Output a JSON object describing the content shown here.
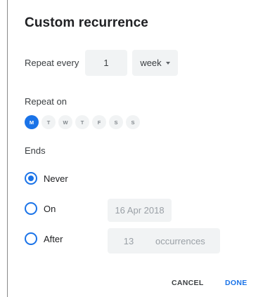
{
  "dialog": {
    "title": "Custom recurrence"
  },
  "repeat": {
    "label": "Repeat every",
    "interval": "1",
    "unit": "week"
  },
  "repeat_on": {
    "label": "Repeat on",
    "days": [
      {
        "letter": "M",
        "selected": true
      },
      {
        "letter": "T",
        "selected": false
      },
      {
        "letter": "W",
        "selected": false
      },
      {
        "letter": "T",
        "selected": false
      },
      {
        "letter": "F",
        "selected": false
      },
      {
        "letter": "S",
        "selected": false
      },
      {
        "letter": "S",
        "selected": false
      }
    ]
  },
  "ends": {
    "label": "Ends",
    "never_label": "Never",
    "on_label": "On",
    "on_date": "16 Apr 2018",
    "after_label": "After",
    "after_count": "13",
    "after_unit": "occurrences",
    "selected": "never"
  },
  "actions": {
    "cancel": "CANCEL",
    "done": "DONE"
  },
  "colors": {
    "accent": "#1a73e8",
    "field_bg": "#f1f3f4"
  }
}
